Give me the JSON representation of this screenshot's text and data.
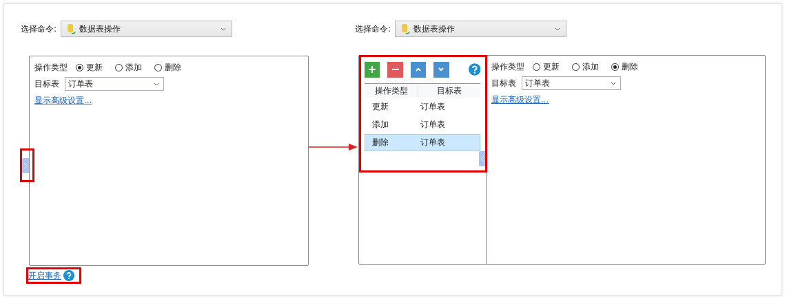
{
  "panels": [
    {
      "kind": "single",
      "command_label": "选择命令:",
      "command": "数据表操作",
      "form": {
        "op_label": "操作类型",
        "options": [
          {
            "label": "更新",
            "selected": true
          },
          {
            "label": "添加",
            "selected": false
          },
          {
            "label": "删除",
            "selected": false
          }
        ],
        "target_label": "目标表",
        "target": "订单表",
        "advanced_link": "显示高级设置..."
      },
      "footer_link": "开启事务"
    },
    {
      "kind": "list",
      "command_label": "选择命令:",
      "command": "数据表操作",
      "table": {
        "columns": [
          "操作类型",
          "目标表"
        ],
        "rows": [
          {
            "cells": [
              "更新",
              "订单表"
            ],
            "selected": false
          },
          {
            "cells": [
              "添加",
              "订单表"
            ],
            "selected": false
          },
          {
            "cells": [
              "删除",
              "订单表"
            ],
            "selected": true
          }
        ]
      },
      "form": {
        "op_label": "操作类型",
        "options": [
          {
            "label": "更新",
            "selected": false
          },
          {
            "label": "添加",
            "selected": false
          },
          {
            "label": "删除",
            "selected": true
          }
        ],
        "target_label": "目标表",
        "target": "订单表",
        "advanced_link": "显示高级设置..."
      }
    }
  ]
}
